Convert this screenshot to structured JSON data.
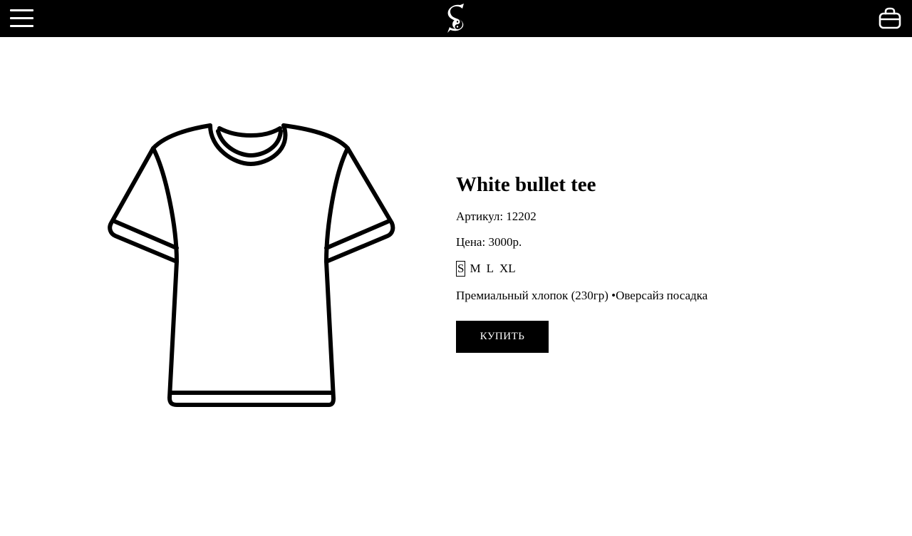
{
  "header": {
    "menu_icon": "hamburger-menu-icon",
    "logo": "s-yin-yang-logo",
    "cart_icon": "shopping-bag-icon",
    "background": "#000000",
    "foreground": "#ffffff"
  },
  "product": {
    "image_icon": "t-shirt-outline",
    "title": "White bullet tee",
    "article": "Артикул: 12202",
    "price": "Цена: 3000р.",
    "sizes": [
      "S",
      "M",
      "L",
      "XL"
    ],
    "selected_size": "S",
    "description": "Премиальный хлопок (230гр) •Оверсайз посадка",
    "buy_label": "КУПИТЬ"
  }
}
